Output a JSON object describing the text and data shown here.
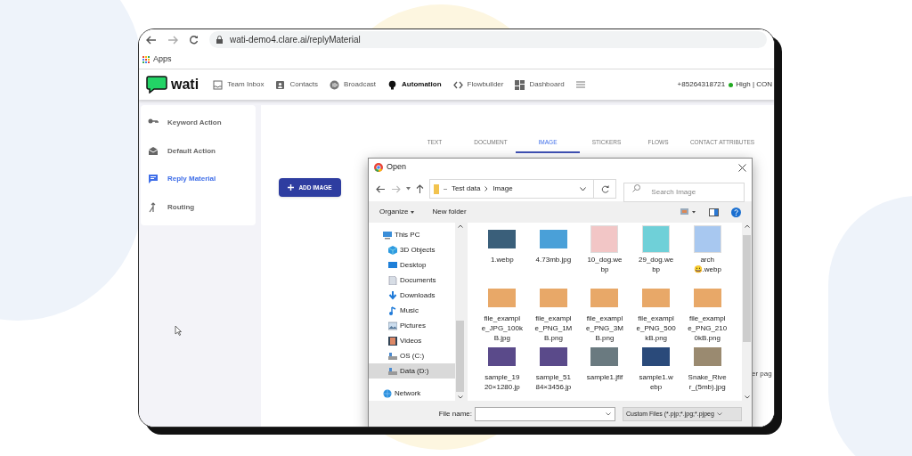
{
  "browser": {
    "url": "wati-demo4.clare.ai/replyMaterial",
    "bookmarks": [
      {
        "label": "Apps"
      }
    ]
  },
  "app": {
    "logo": "wati",
    "nav": [
      {
        "label": "Team Inbox",
        "kind": "inbox",
        "selected": false
      },
      {
        "label": "Contacts",
        "kind": "contacts",
        "selected": false
      },
      {
        "label": "Broadcast",
        "kind": "broadcast",
        "selected": false
      },
      {
        "label": "Automation",
        "kind": "bulb",
        "selected": true
      },
      {
        "label": "Flowbuilder",
        "kind": "code",
        "selected": false
      },
      {
        "label": "Dashboard",
        "kind": "dashboard",
        "selected": false
      }
    ],
    "phone": "+85264318721",
    "status": {
      "label": "High | CON",
      "color": "#22aa22"
    }
  },
  "sidebar": {
    "items": [
      {
        "label": "Keyword Action",
        "kind": "key",
        "selected": false
      },
      {
        "label": "Default Action",
        "kind": "mail",
        "selected": false
      },
      {
        "label": "Reply Material",
        "kind": "chat",
        "selected": true
      },
      {
        "label": "Routing",
        "kind": "route",
        "selected": false
      }
    ]
  },
  "main": {
    "tabs": [
      {
        "label": "TEXT",
        "selected": false
      },
      {
        "label": "DOCUMENT",
        "selected": false
      },
      {
        "label": "IMAGE",
        "selected": true
      },
      {
        "label": "STICKERS",
        "selected": false
      },
      {
        "label": "FLOWS",
        "selected": false
      },
      {
        "label": "CONTACT ATTRIBUTES",
        "selected": false
      }
    ],
    "add_button": "ADD IMAGE",
    "hidden_text": "er pag"
  },
  "dialog": {
    "title": "Open",
    "path": [
      "Test data",
      "Image"
    ],
    "search_placeholder": "Search Image",
    "toolbar": [
      "Organize",
      "New folder"
    ],
    "tree": [
      {
        "label": "This PC",
        "kind": "pc",
        "selected": false
      },
      {
        "label": "3D Objects",
        "kind": "cube",
        "selected": false
      },
      {
        "label": "Desktop",
        "kind": "desktop",
        "selected": false
      },
      {
        "label": "Documents",
        "kind": "doc",
        "selected": false
      },
      {
        "label": "Downloads",
        "kind": "download",
        "selected": false
      },
      {
        "label": "Music",
        "kind": "music",
        "selected": false
      },
      {
        "label": "Pictures",
        "kind": "pictures",
        "selected": false
      },
      {
        "label": "Videos",
        "kind": "videos",
        "selected": false
      },
      {
        "label": "OS (C:)",
        "kind": "drive",
        "selected": false
      },
      {
        "label": "Data (D:)",
        "kind": "drive",
        "selected": true
      },
      {
        "label": "Network",
        "kind": "network",
        "selected": false
      }
    ],
    "files": [
      {
        "name": "1.webp",
        "color": "#3a5f7a"
      },
      {
        "name": "4.73mb.jpg",
        "color": "#4aa0d8"
      },
      {
        "name": "10_dog.we\nbp",
        "color": "#f2c6c6"
      },
      {
        "name": "29_dog.we\nbp",
        "color": "#6fd0d8"
      },
      {
        "name": "arch\n😀.webp",
        "color": "#a8c8f0"
      },
      {
        "name": "file_exampl\ne_JPG_100k\nB.jpg",
        "color": "#e8a868"
      },
      {
        "name": "file_exampl\ne_PNG_1M\nB.png",
        "color": "#e8a868"
      },
      {
        "name": "file_exampl\ne_PNG_3M\nB.png",
        "color": "#e8a868"
      },
      {
        "name": "file_exampl\ne_PNG_500\nkB.png",
        "color": "#e8a868"
      },
      {
        "name": "file_exampl\ne_PNG_210\n0kB.png",
        "color": "#e8a868"
      },
      {
        "name": "sample_19\n20×1280.jp",
        "color": "#5a4a8a"
      },
      {
        "name": "sample_51\n84×3456.jp",
        "color": "#5a4a8a"
      },
      {
        "name": "sample1.jfif",
        "color": "#6a7a80"
      },
      {
        "name": "sample1.w\nebp",
        "color": "#2a4a7a"
      },
      {
        "name": "Snake_Rive\nr_(5mb).jpg",
        "color": "#9a8a70"
      }
    ],
    "file_name_label": "File name:",
    "filter": "Custom Files (*.pjp;*.jpg;*.pjpeg"
  }
}
